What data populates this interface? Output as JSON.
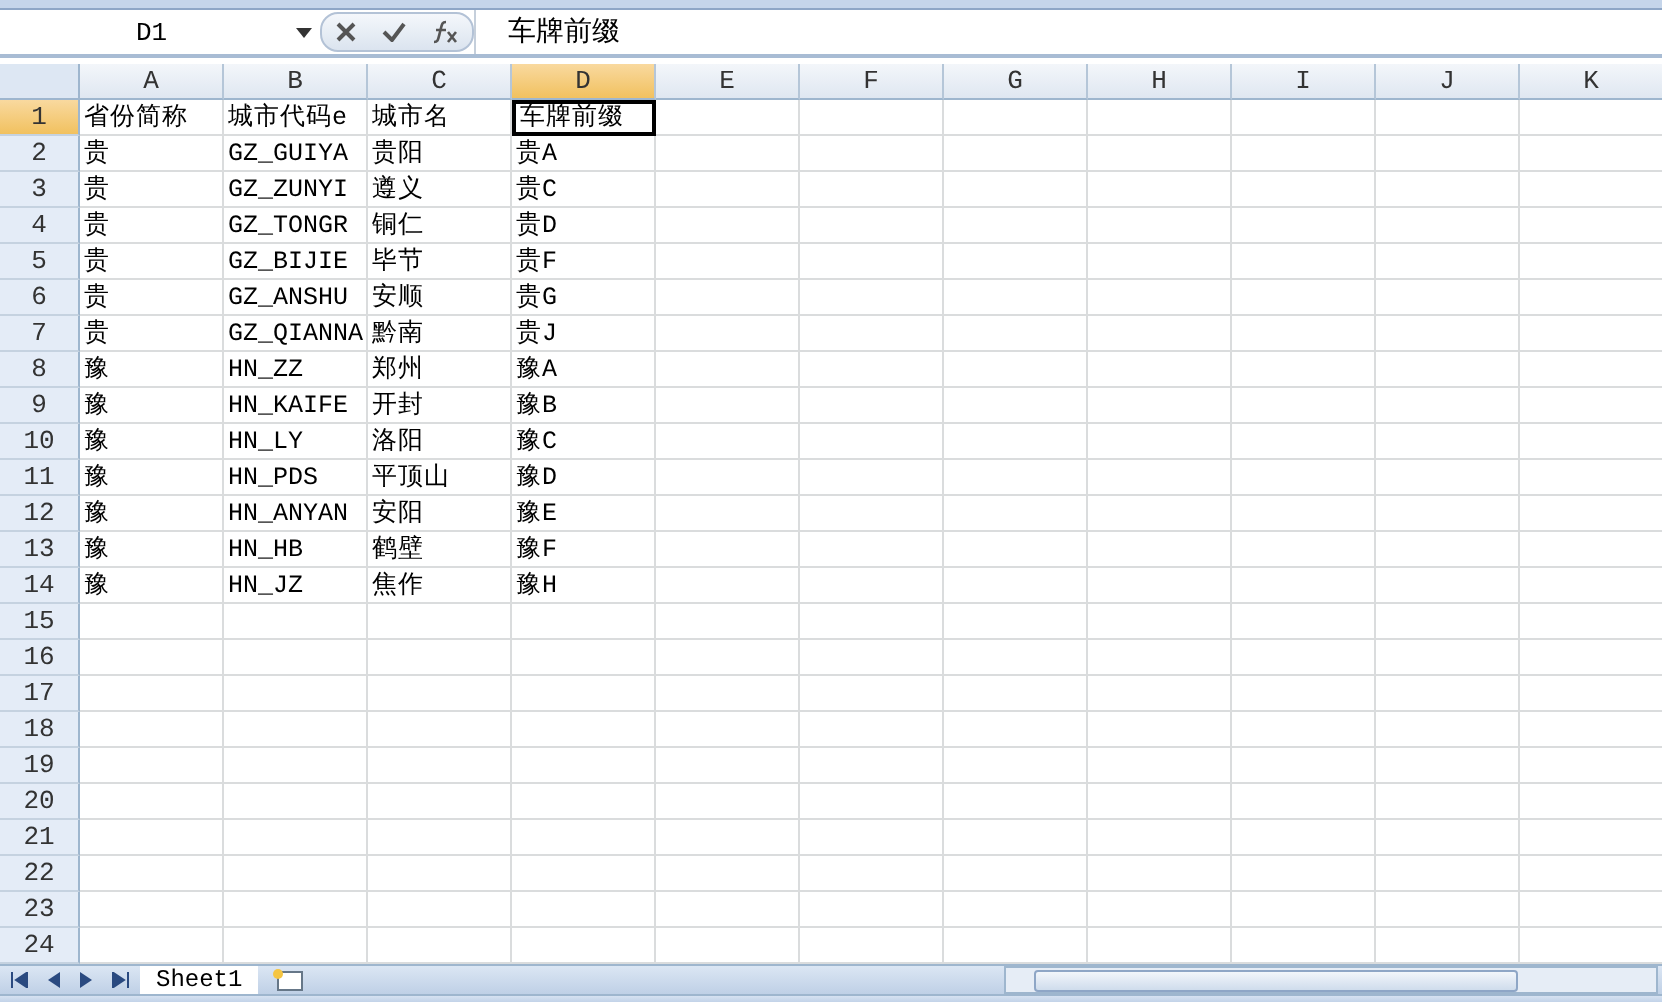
{
  "name_box": "D1",
  "formula": "车牌前缀",
  "columns": [
    {
      "label": "A",
      "selected": false
    },
    {
      "label": "B",
      "selected": false
    },
    {
      "label": "C",
      "selected": false
    },
    {
      "label": "D",
      "selected": true
    },
    {
      "label": "E",
      "selected": false
    },
    {
      "label": "F",
      "selected": false
    },
    {
      "label": "G",
      "selected": false
    },
    {
      "label": "H",
      "selected": false
    },
    {
      "label": "I",
      "selected": false
    },
    {
      "label": "J",
      "selected": false
    },
    {
      "label": "K",
      "selected": false
    }
  ],
  "rows": [
    {
      "number": "1",
      "selected": true,
      "cells": [
        {
          "text": "省份简称",
          "selected": false
        },
        {
          "text": "城市代码e",
          "selected": false
        },
        {
          "text": "城市名",
          "selected": false
        },
        {
          "text": "车牌前缀",
          "selected": true
        }
      ]
    },
    {
      "number": "2",
      "selected": false,
      "cells": [
        {
          "text": "贵",
          "selected": false
        },
        {
          "text": "GZ_GUIYA",
          "selected": false
        },
        {
          "text": "贵阳",
          "selected": false
        },
        {
          "text": "贵A",
          "selected": false
        }
      ]
    },
    {
      "number": "3",
      "selected": false,
      "cells": [
        {
          "text": "贵",
          "selected": false
        },
        {
          "text": "GZ_ZUNYI",
          "selected": false
        },
        {
          "text": "遵义",
          "selected": false
        },
        {
          "text": "贵C",
          "selected": false
        }
      ]
    },
    {
      "number": "4",
      "selected": false,
      "cells": [
        {
          "text": "贵",
          "selected": false
        },
        {
          "text": "GZ_TONGR",
          "selected": false
        },
        {
          "text": "铜仁",
          "selected": false
        },
        {
          "text": "贵D",
          "selected": false
        }
      ]
    },
    {
      "number": "5",
      "selected": false,
      "cells": [
        {
          "text": "贵",
          "selected": false
        },
        {
          "text": "GZ_BIJIE",
          "selected": false
        },
        {
          "text": "毕节",
          "selected": false
        },
        {
          "text": "贵F",
          "selected": false
        }
      ]
    },
    {
      "number": "6",
      "selected": false,
      "cells": [
        {
          "text": "贵",
          "selected": false
        },
        {
          "text": "GZ_ANSHU",
          "selected": false
        },
        {
          "text": "安顺",
          "selected": false
        },
        {
          "text": "贵G",
          "selected": false
        }
      ]
    },
    {
      "number": "7",
      "selected": false,
      "cells": [
        {
          "text": "贵",
          "selected": false
        },
        {
          "text": "GZ_QIANNA",
          "selected": false
        },
        {
          "text": "黔南",
          "selected": false
        },
        {
          "text": "贵J",
          "selected": false
        }
      ]
    },
    {
      "number": "8",
      "selected": false,
      "cells": [
        {
          "text": "豫",
          "selected": false
        },
        {
          "text": "HN_ZZ",
          "selected": false
        },
        {
          "text": "郑州",
          "selected": false
        },
        {
          "text": "豫A",
          "selected": false
        }
      ]
    },
    {
      "number": "9",
      "selected": false,
      "cells": [
        {
          "text": "豫",
          "selected": false
        },
        {
          "text": "HN_KAIFE",
          "selected": false
        },
        {
          "text": "开封",
          "selected": false
        },
        {
          "text": "豫B",
          "selected": false
        }
      ]
    },
    {
      "number": "10",
      "selected": false,
      "cells": [
        {
          "text": "豫",
          "selected": false
        },
        {
          "text": "HN_LY",
          "selected": false
        },
        {
          "text": "洛阳",
          "selected": false
        },
        {
          "text": "豫C",
          "selected": false
        }
      ]
    },
    {
      "number": "11",
      "selected": false,
      "cells": [
        {
          "text": "豫",
          "selected": false
        },
        {
          "text": "HN_PDS",
          "selected": false
        },
        {
          "text": "平顶山",
          "selected": false
        },
        {
          "text": "豫D",
          "selected": false
        }
      ]
    },
    {
      "number": "12",
      "selected": false,
      "cells": [
        {
          "text": "豫",
          "selected": false
        },
        {
          "text": "HN_ANYAN",
          "selected": false
        },
        {
          "text": "安阳",
          "selected": false
        },
        {
          "text": "豫E",
          "selected": false
        }
      ]
    },
    {
      "number": "13",
      "selected": false,
      "cells": [
        {
          "text": "豫",
          "selected": false
        },
        {
          "text": "HN_HB",
          "selected": false
        },
        {
          "text": "鹤壁",
          "selected": false
        },
        {
          "text": "豫F",
          "selected": false
        }
      ]
    },
    {
      "number": "14",
      "selected": false,
      "cells": [
        {
          "text": "豫",
          "selected": false
        },
        {
          "text": "HN_JZ",
          "selected": false
        },
        {
          "text": "焦作",
          "selected": false
        },
        {
          "text": "豫H",
          "selected": false
        }
      ]
    },
    {
      "number": "15",
      "selected": false
    },
    {
      "number": "16",
      "selected": false
    },
    {
      "number": "17",
      "selected": false
    },
    {
      "number": "18",
      "selected": false
    },
    {
      "number": "19",
      "selected": false
    },
    {
      "number": "20",
      "selected": false
    },
    {
      "number": "21",
      "selected": false
    },
    {
      "number": "22",
      "selected": false
    },
    {
      "number": "23",
      "selected": false
    },
    {
      "number": "24",
      "selected": false
    }
  ],
  "sheet_tabs": [
    {
      "label": "Sheet1",
      "selected": true
    }
  ]
}
